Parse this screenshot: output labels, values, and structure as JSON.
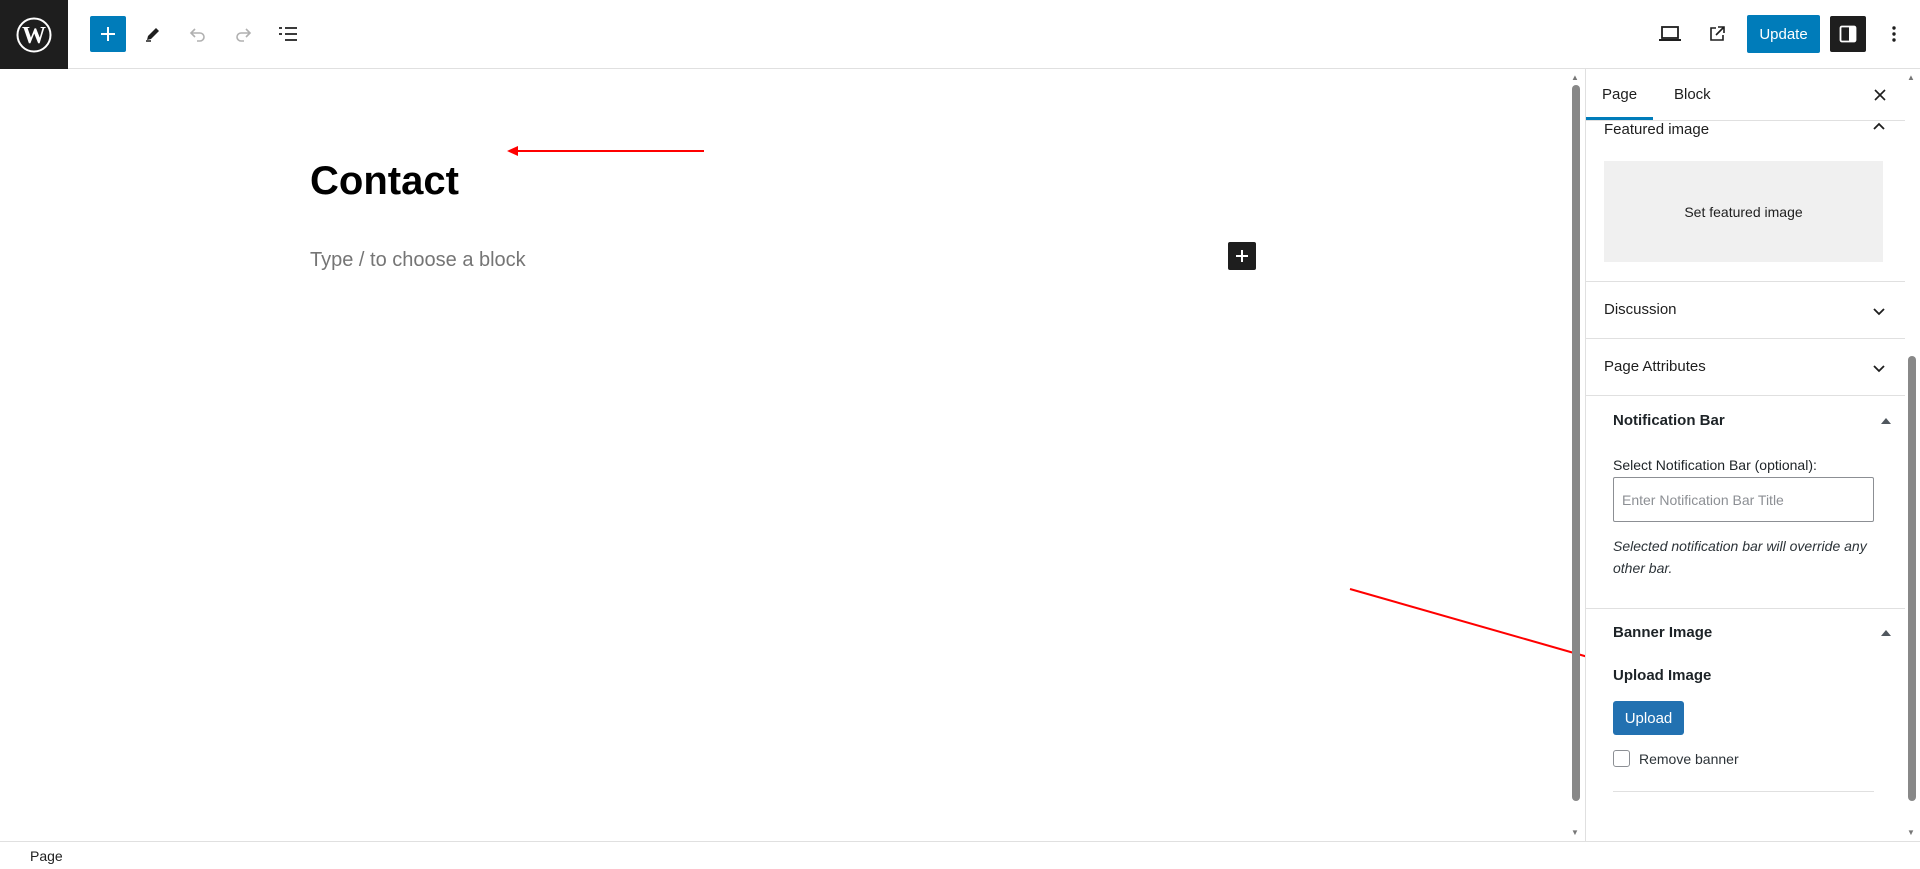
{
  "toolbar": {
    "logo_icon": "wordpress-logo-icon",
    "update_label": "Update"
  },
  "editor": {
    "title": "Contact",
    "block_placeholder": "Type / to choose a block"
  },
  "sidebar": {
    "tabs": [
      {
        "label": "Page"
      },
      {
        "label": "Block"
      }
    ],
    "featured_image": {
      "heading": "Featured image",
      "button_label": "Set featured image"
    },
    "discussion": {
      "heading": "Discussion"
    },
    "page_attributes": {
      "heading": "Page Attributes"
    },
    "notification_bar": {
      "heading": "Notification Bar",
      "field_label": "Select Notification Bar (optional):",
      "input_placeholder": "Enter Notification Bar Title",
      "input_value": "",
      "description": "Selected notification bar will override any other bar."
    },
    "banner_image": {
      "heading": "Banner Image",
      "upload_label": "Upload Image",
      "upload_button": "Upload",
      "remove_label": "Remove banner",
      "remove_checked": false
    }
  },
  "footer": {
    "breadcrumb": "Page"
  },
  "colors": {
    "accent": "#007cba",
    "wp_button": "#2271b1",
    "annotation_arrow": "#ff0000",
    "dark": "#1e1e1e"
  }
}
